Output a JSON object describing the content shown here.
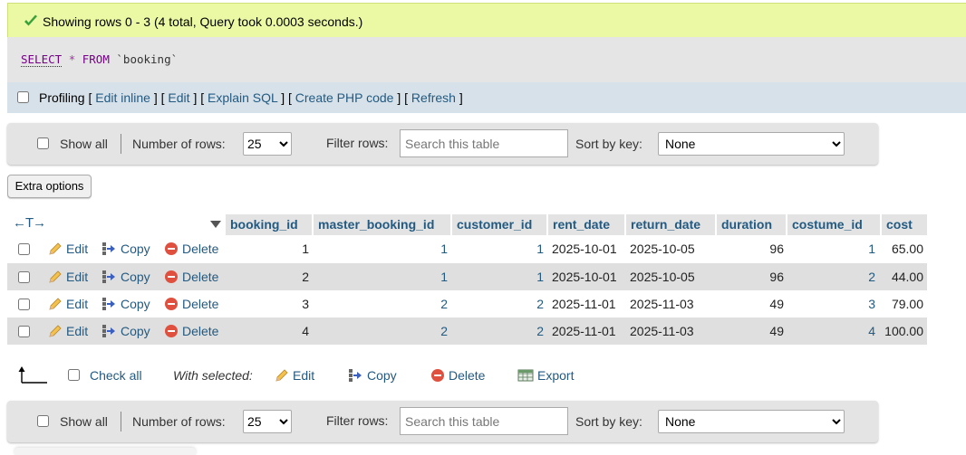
{
  "status": {
    "message": "Showing rows 0 - 3 (4 total, Query took 0.0003 seconds.)"
  },
  "sql": {
    "select": "SELECT",
    "star": "*",
    "from": "FROM",
    "table": "`booking`"
  },
  "profiling": {
    "label": "Profiling",
    "open": "[",
    "close": "]",
    "sep": "] [",
    "edit_inline": "Edit inline",
    "edit": "Edit",
    "explain_sql": "Explain SQL",
    "create_php": "Create PHP code",
    "refresh": "Refresh"
  },
  "navigation": {
    "show_all": "Show all",
    "number_of_rows_label": "Number of rows:",
    "number_of_rows_value": "25",
    "filter_label": "Filter rows:",
    "filter_placeholder": "Search this table",
    "sort_label": "Sort by key:",
    "sort_value": "None"
  },
  "extra_options": "Extra options",
  "table": {
    "arrows": "←T→",
    "columns": [
      "booking_id",
      "master_booking_id",
      "customer_id",
      "rent_date",
      "return_date",
      "duration",
      "costume_id",
      "cost"
    ],
    "actions": {
      "edit": "Edit",
      "copy": "Copy",
      "delete": "Delete"
    },
    "rows": [
      {
        "booking_id": "1",
        "master_booking_id": "1",
        "customer_id": "1",
        "rent_date": "2025-10-01",
        "return_date": "2025-10-05",
        "duration": "96",
        "costume_id": "1",
        "cost": "65.00"
      },
      {
        "booking_id": "2",
        "master_booking_id": "1",
        "customer_id": "1",
        "rent_date": "2025-10-01",
        "return_date": "2025-10-05",
        "duration": "96",
        "costume_id": "2",
        "cost": "44.00"
      },
      {
        "booking_id": "3",
        "master_booking_id": "2",
        "customer_id": "2",
        "rent_date": "2025-11-01",
        "return_date": "2025-11-03",
        "duration": "49",
        "costume_id": "3",
        "cost": "79.00"
      },
      {
        "booking_id": "4",
        "master_booking_id": "2",
        "customer_id": "2",
        "rent_date": "2025-11-01",
        "return_date": "2025-11-03",
        "duration": "49",
        "costume_id": "4",
        "cost": "100.00"
      }
    ]
  },
  "bulk": {
    "check_all": "Check all",
    "with_selected": "With selected:",
    "edit": "Edit",
    "copy": "Copy",
    "delete": "Delete",
    "export": "Export"
  },
  "colors": {
    "link": "#235a81",
    "success_bg": "#ebf8a4",
    "row_alt": "#dfdfdf",
    "header_bg": "#e3e3e3"
  }
}
